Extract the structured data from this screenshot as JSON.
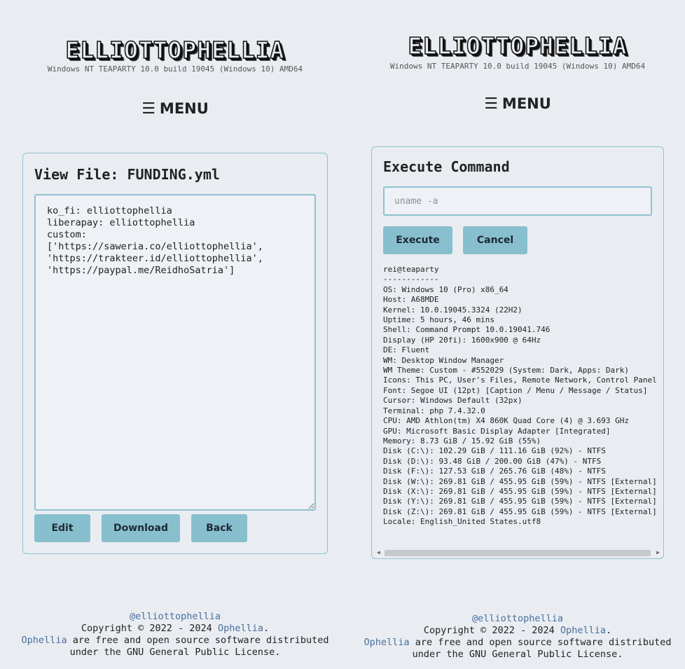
{
  "left": {
    "logo": "ELLIOTTOPHELLIA",
    "system_info": "Windows NT TEAPARTY 10.0 build 19045 (Windows 10) AMD64",
    "menu": {
      "icon": "hamburger-icon",
      "label": "MENU"
    },
    "card_title": "View File: FUNDING.yml",
    "file_content": "ko_fi: elliottophellia\nliberapay: elliottophellia\ncustom:\n['https://saweria.co/elliottophellia',\n'https://trakteer.id/elliottophellia',\n'https://paypal.me/ReidhoSatria']",
    "buttons": {
      "edit": "Edit",
      "download": "Download",
      "back": "Back"
    },
    "footer": {
      "handle": "@elliottophellia",
      "copyright_prefix": "Copyright © 2022 - 2024",
      "copyright_link": "Ophellia",
      "copyright_suffix": ".",
      "license_link": "Ophellia",
      "license_line1": " are free and open source software distributed",
      "license_line2": "under the GNU General Public License."
    }
  },
  "right": {
    "logo": "ELLIOTTOPHELLIA",
    "system_info": "Windows NT TEAPARTY 10.0 build 19045 (Windows 10) AMD64",
    "menu": {
      "icon": "hamburger-icon",
      "label": "MENU"
    },
    "card_title": "Execute Command",
    "command_placeholder": "uname -a",
    "buttons": {
      "execute": "Execute",
      "cancel": "Cancel"
    },
    "output_lines": [
      "rei@teaparty",
      "------------",
      "OS: Windows 10 (Pro) x86_64",
      "Host: A68MDE",
      "Kernel: 10.0.19045.3324 (22H2)",
      "Uptime: 5 hours, 46 mins",
      "Shell: Command Prompt 10.0.19041.746",
      "Display (HP 20fi): 1600x900 @ 64Hz",
      "DE: Fluent",
      "WM: Desktop Window Manager",
      "WM Theme: Custom - #552029 (System: Dark, Apps: Dark)",
      "Icons: This PC, User's Files, Remote Network, Control Panel",
      "Font: Segoe UI (12pt) [Caption / Menu / Message / Status]",
      "Cursor: Windows Default (32px)",
      "Terminal: php 7.4.32.0",
      "CPU: AMD Athlon(tm) X4 860K Quad Core (4) @ 3.693 GHz",
      "GPU: Microsoft Basic Display Adapter [Integrated]",
      "Memory: 8.73 GiB / 15.92 GiB (55%)",
      "Disk (C:\\): 102.29 GiB / 111.16 GiB (92%) - NTFS",
      "Disk (D:\\): 93.48 GiB / 200.00 GiB (47%) - NTFS",
      "Disk (F:\\): 127.53 GiB / 265.76 GiB (48%) - NTFS",
      "Disk (W:\\): 269.81 GiB / 455.95 GiB (59%) - NTFS [External]",
      "Disk (X:\\): 269.81 GiB / 455.95 GiB (59%) - NTFS [External]",
      "Disk (Y:\\): 269.81 GiB / 455.95 GiB (59%) - NTFS [External]",
      "Disk (Z:\\): 269.81 GiB / 455.95 GiB (59%) - NTFS [External]",
      "Locale: English_United States.utf8"
    ],
    "footer": {
      "handle": "@elliottophellia",
      "copyright_prefix": "Copyright © 2022 - 2024",
      "copyright_link": "Ophellia",
      "copyright_suffix": ".",
      "license_link": "Ophellia",
      "license_line1": " are free and open source software distributed",
      "license_line2": "under the GNU General Public License."
    }
  }
}
